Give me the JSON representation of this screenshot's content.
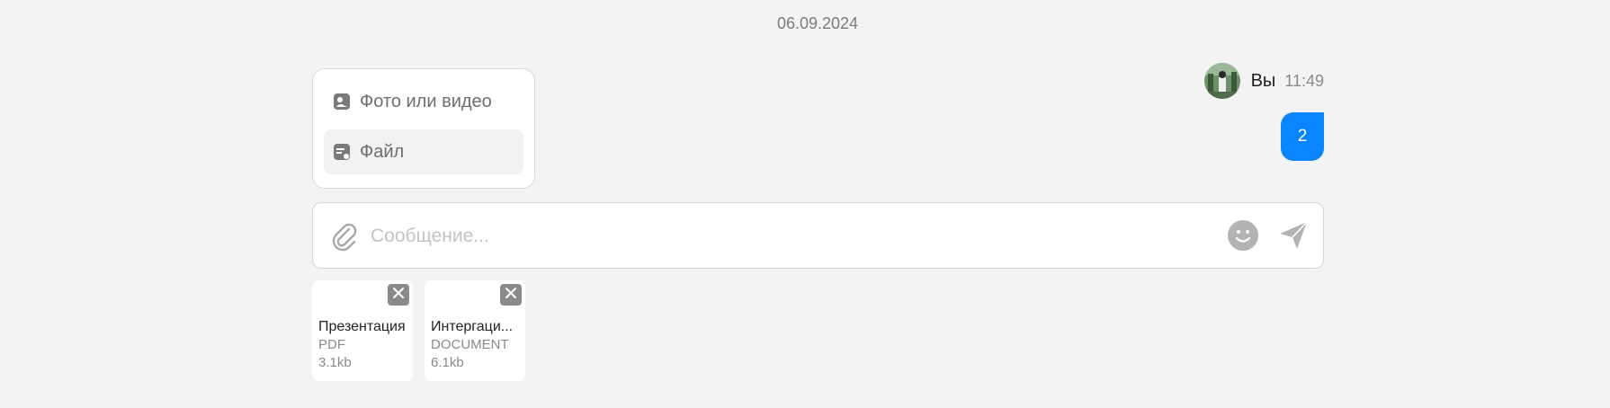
{
  "date_separator": "06.09.2024",
  "attach_menu": {
    "items": [
      {
        "label": "Фото или видео",
        "icon": "image-icon"
      },
      {
        "label": "Файл",
        "icon": "file-icon"
      }
    ]
  },
  "message": {
    "author": "Вы",
    "time": "11:49",
    "text": "2"
  },
  "composer": {
    "placeholder": "Сообщение..."
  },
  "attachments": [
    {
      "name": "Презентация",
      "type": "PDF",
      "size": "3.1kb"
    },
    {
      "name": "Интергаци...",
      "type": "DOCUMENT",
      "size": "6.1kb"
    }
  ],
  "colors": {
    "accent": "#0a84ff",
    "background": "#f3f3f3"
  }
}
